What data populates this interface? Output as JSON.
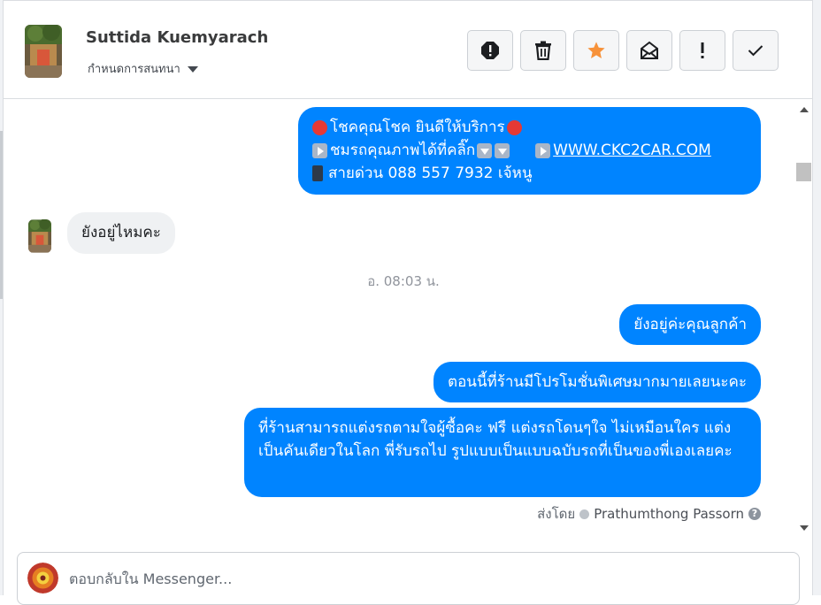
{
  "header": {
    "contact_name": "Suttida Kuemyarach",
    "assign_label": "กำหนดการสนทนา",
    "actions": [
      "block-icon",
      "trash-icon",
      "star-icon",
      "mark-unread-icon",
      "follow-up-icon",
      "done-icon"
    ]
  },
  "messages": {
    "m1": {
      "line1": "โชคคุณโชค ยินดีให้บริการ",
      "line2_text": "ชมรถคุณภาพได้ที่คลิ๊ก",
      "line2_link": "WWW.CKC2CAR.COM",
      "line3": "สายด่วน 088 557 7932 เจ้หนู"
    },
    "m2": "ยังอยู่ไหมคะ",
    "timestamp": "อ. 08:03 น.",
    "m3": "ยังอยู่ค่ะคุณลูกค้า",
    "m4": "ตอนนี้ที่ร้านมีโปรโมชั่นพิเศษมากมายเลยนะคะ",
    "m5": "ที่ร้านสามารถแต่งรถตามใจผู้ซื้อคะ ฟรี แต่งรถโดนๆใจ ไม่เหมือนใคร แต่งเป็นคันเดียวในโลก พี่รับรถไป รูปแบบเป็นแบบฉบับรถที่เป็นของพี่เองเลยคะ",
    "sent_by_label": "ส่งโดย",
    "sent_by_agent": "Prathumthong Passorn"
  },
  "reply": {
    "placeholder": "ตอบกลับใน Messenger..."
  },
  "colors": {
    "outgoing": "#0084ff",
    "incoming": "#eff1f3",
    "star": "#f7923a"
  }
}
